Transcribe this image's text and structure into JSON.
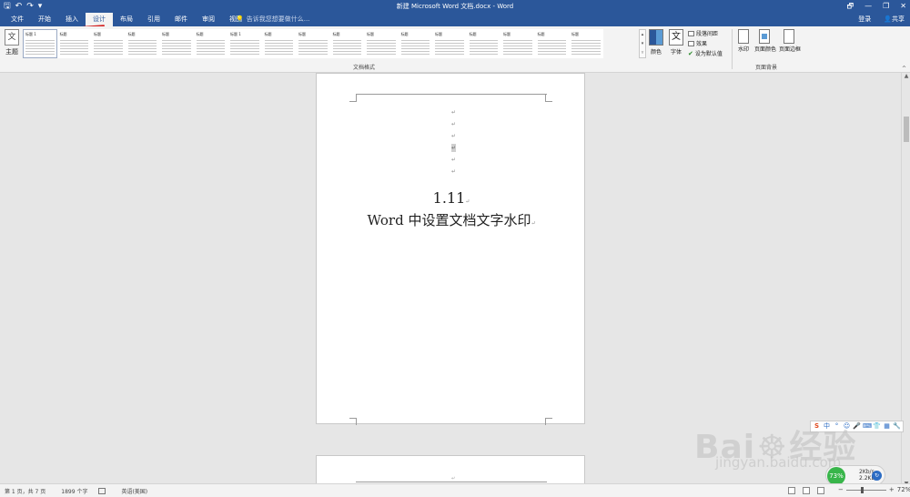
{
  "app": {
    "title": "新建 Microsoft Word 文档.docx - Word",
    "qat": {
      "save_glyph": "🖫",
      "undo_glyph": "↶",
      "redo_glyph": "↷",
      "more_glyph": "▾"
    },
    "window_controls": [
      "🗗",
      "—",
      "❐",
      "✕"
    ]
  },
  "tabs": [
    {
      "label": "文件"
    },
    {
      "label": "开始"
    },
    {
      "label": "插入"
    },
    {
      "label": "设计"
    },
    {
      "label": "布局"
    },
    {
      "label": "引用"
    },
    {
      "label": "邮件"
    },
    {
      "label": "审阅"
    },
    {
      "label": "视图"
    }
  ],
  "tellme": {
    "icon": "lightbulb-icon",
    "text": "告诉我您想要做什么..."
  },
  "account": {
    "login": "登录",
    "share": "共享"
  },
  "ribbon": {
    "theme_label": "主题",
    "theme_glyph": "文",
    "style_gallery": [
      {
        "title": "标题 1"
      },
      {
        "title": "标题"
      },
      {
        "title": "标题"
      },
      {
        "title": "标题"
      },
      {
        "title": "标题"
      },
      {
        "title": "标题"
      },
      {
        "title": "标题 1"
      },
      {
        "title": "标题"
      },
      {
        "title": "标题"
      },
      {
        "title": "标题"
      },
      {
        "title": "标题"
      },
      {
        "title": "标题"
      },
      {
        "title": "标题"
      },
      {
        "title": "标题"
      },
      {
        "title": "标题"
      },
      {
        "title": "标题"
      },
      {
        "title": "标题"
      }
    ],
    "gallery_group_label": "文档格式",
    "colors_label": "颜色",
    "fonts_label": "字体",
    "fonts_glyph": "文",
    "para_spacing_label": "段落间距",
    "effects_label": "效果",
    "set_default_label": "设为默认值",
    "check_glyph": "✔",
    "watermark_label": "水印",
    "page_color_label": "页面颜色",
    "page_borders_label": "页面边框",
    "page_bg_group_label": "页面背景",
    "collapse_glyph": "^"
  },
  "document": {
    "para_mark": "↵",
    "heading_number": "1.11",
    "heading_title": "Word 中设置文档文字水印",
    "title_mark": "↵"
  },
  "status": {
    "page": "第 1 页，共 7 页",
    "words": "1899 个字",
    "language": "英语(美国)",
    "zoom": "72%",
    "zoom_minus": "−",
    "zoom_plus": "+"
  },
  "net_widget": {
    "percent": "73%",
    "up": "2Kb/s",
    "down": "2.2Kb/s",
    "glyph": "↻"
  },
  "watermark": {
    "brand_left": "Bai",
    "brand_right": "经验",
    "paw": "☸",
    "url": "jingyan.baidu.com"
  },
  "colors": {
    "titlebar": "#2b579a",
    "annotation": "#d32020"
  }
}
